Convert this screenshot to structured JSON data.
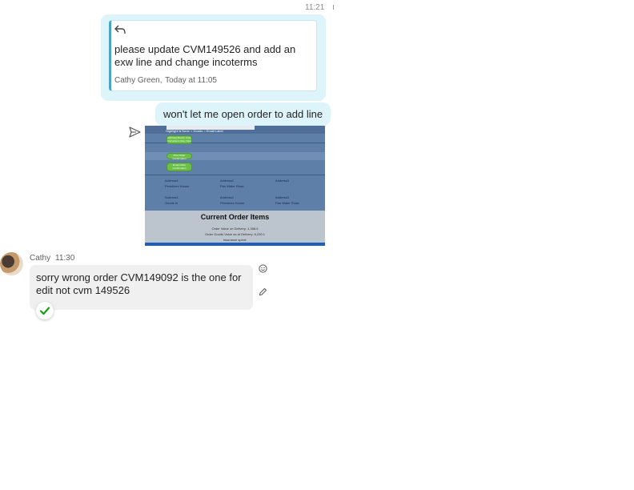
{
  "outgoing": {
    "timestamp": "11:21",
    "quoted_text": "please update CVM149526 and add an exw line and change incoterms",
    "quoted_sender": "Cathy Green",
    "quoted_time": "Today at 11:05",
    "reply_text": "won't let me open order to add line"
  },
  "screenshot": {
    "highlight_label": "Highlight",
    "highlight_options": [
      "None",
      "Goods",
      "Email Label"
    ],
    "buttons": [
      "Add New Return Cust. Instructions Req. Note",
      "Print Order Confirmation",
      "Email Order Confirmation"
    ],
    "labels": [
      {
        "text": "Address1",
        "col": 0,
        "row": 0
      },
      {
        "text": "Address2",
        "col": 1,
        "row": 0
      },
      {
        "text": "Address3",
        "col": 2,
        "row": 0
      },
      {
        "text": "Pennlines House",
        "col": 0,
        "row": 1
      },
      {
        "text": "Pan Water Road",
        "col": 1,
        "row": 1
      },
      {
        "text": "Address1",
        "col": 0,
        "row": 2
      },
      {
        "text": "Address2",
        "col": 1,
        "row": 2
      },
      {
        "text": "Address3",
        "col": 2,
        "row": 2
      },
      {
        "text": "Goods In",
        "col": 0,
        "row": 3
      },
      {
        "text": "Pennlines House",
        "col": 1,
        "row": 3
      },
      {
        "text": "Pan Water Road",
        "col": 2,
        "row": 3
      }
    ],
    "title": "Current Order Items",
    "info_lines": [
      "Order Value on Delivery: 1,358.5",
      "Order Goods Value as at Delivery: 6,230.1",
      "Insurance spent:"
    ]
  },
  "incoming": {
    "sender": "Cathy",
    "time": "11:30",
    "text": "sorry wrong order CVM149092 is the one for edit not cvm 149526"
  },
  "icons": {
    "reply": "reply-arrow-icon",
    "send": "send-icon",
    "emoji": "emoji-icon",
    "edit": "pencil-icon",
    "check": "check-icon"
  },
  "colors": {
    "outgoing_bubble": "#def4fb",
    "incoming_bubble": "#f0f0f0",
    "accent": "#4aa6c9",
    "check": "#13a10e"
  }
}
